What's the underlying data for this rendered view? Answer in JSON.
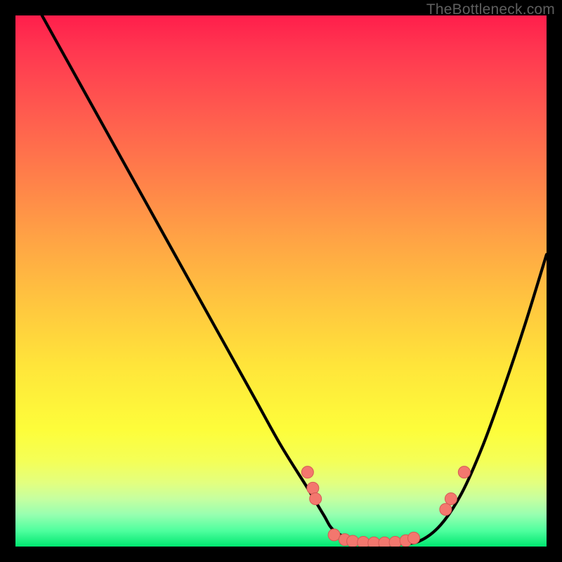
{
  "watermark": "TheBottleneck.com",
  "colors": {
    "gradient_top": "#ff1e4b",
    "gradient_mid": "#ffe53a",
    "gradient_bottom": "#00e770",
    "frame": "#000000",
    "curve": "#000000",
    "markers_fill": "#f3776e",
    "markers_stroke": "#d55a55"
  },
  "chart_data": {
    "type": "line",
    "title": "",
    "xlabel": "",
    "ylabel": "",
    "xlim": [
      0,
      100
    ],
    "ylim": [
      0,
      100
    ],
    "grid": false,
    "note": "V-shaped bottleneck curve; y is inferred % distance from bottom (0) to top (100) on a gradient background. No axis ticks are rendered in the image, so values are estimated from pixel position.",
    "series": [
      {
        "name": "curve",
        "x": [
          5,
          10,
          15,
          20,
          25,
          30,
          35,
          40,
          45,
          50,
          55,
          58,
          60,
          64,
          68,
          72,
          76,
          80,
          84,
          88,
          92,
          96,
          100
        ],
        "y": [
          100,
          91,
          82,
          73,
          64,
          55,
          46,
          37,
          28,
          19,
          11,
          6,
          3,
          1,
          0.5,
          0.5,
          1,
          4,
          10,
          19,
          30,
          42,
          55
        ]
      }
    ],
    "markers": [
      {
        "x": 55.0,
        "y": 14.0
      },
      {
        "x": 56.0,
        "y": 11.0
      },
      {
        "x": 56.5,
        "y": 9.0
      },
      {
        "x": 60.0,
        "y": 2.2
      },
      {
        "x": 62.0,
        "y": 1.3
      },
      {
        "x": 63.5,
        "y": 1.0
      },
      {
        "x": 65.5,
        "y": 0.8
      },
      {
        "x": 67.5,
        "y": 0.7
      },
      {
        "x": 69.5,
        "y": 0.7
      },
      {
        "x": 71.5,
        "y": 0.8
      },
      {
        "x": 73.5,
        "y": 1.1
      },
      {
        "x": 75.0,
        "y": 1.6
      },
      {
        "x": 81.0,
        "y": 7.0
      },
      {
        "x": 82.0,
        "y": 9.0
      },
      {
        "x": 84.5,
        "y": 14.0
      }
    ]
  }
}
